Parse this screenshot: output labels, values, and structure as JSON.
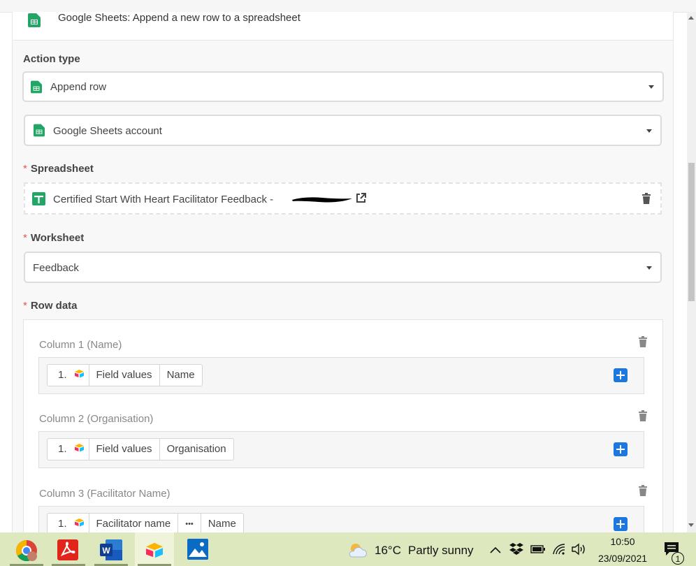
{
  "header": {
    "title": "Google Sheets: Append a new row to a spreadsheet",
    "icon": "google-sheets-icon"
  },
  "action_type": {
    "label": "Action type",
    "value": "Append row"
  },
  "account": {
    "value": "Google Sheets account"
  },
  "spreadsheet": {
    "label": "Spreadsheet",
    "required_mark": "*",
    "value": "Certified Start With Heart Facilitator Feedback -"
  },
  "worksheet": {
    "label": "Worksheet",
    "required_mark": "*",
    "value": "Feedback"
  },
  "row_data": {
    "label": "Row data",
    "required_mark": "*",
    "columns": [
      {
        "label": "Column 1 (Name)",
        "step": "1.",
        "pills": [
          "Field values",
          "Name"
        ]
      },
      {
        "label": "Column 2 (Organisation)",
        "step": "1.",
        "pills": [
          "Field values",
          "Organisation"
        ]
      },
      {
        "label": "Column 3 (Facilitator Name)",
        "step": "1.",
        "pills": [
          "Facilitator name",
          "•••",
          "Name"
        ]
      }
    ]
  },
  "taskbar": {
    "apps": [
      "chrome-icon",
      "acrobat-icon",
      "word-icon",
      "airtable-icon",
      "photos-icon"
    ],
    "weather": {
      "temp": "16°C",
      "condition": "Partly sunny"
    },
    "time": "10:50",
    "date": "23/09/2021",
    "notifications": "1"
  },
  "colors": {
    "accent": "#1c77e0",
    "sheets_green": "#23a566",
    "required": "#e0584a",
    "taskbar": "#dde8bf"
  }
}
